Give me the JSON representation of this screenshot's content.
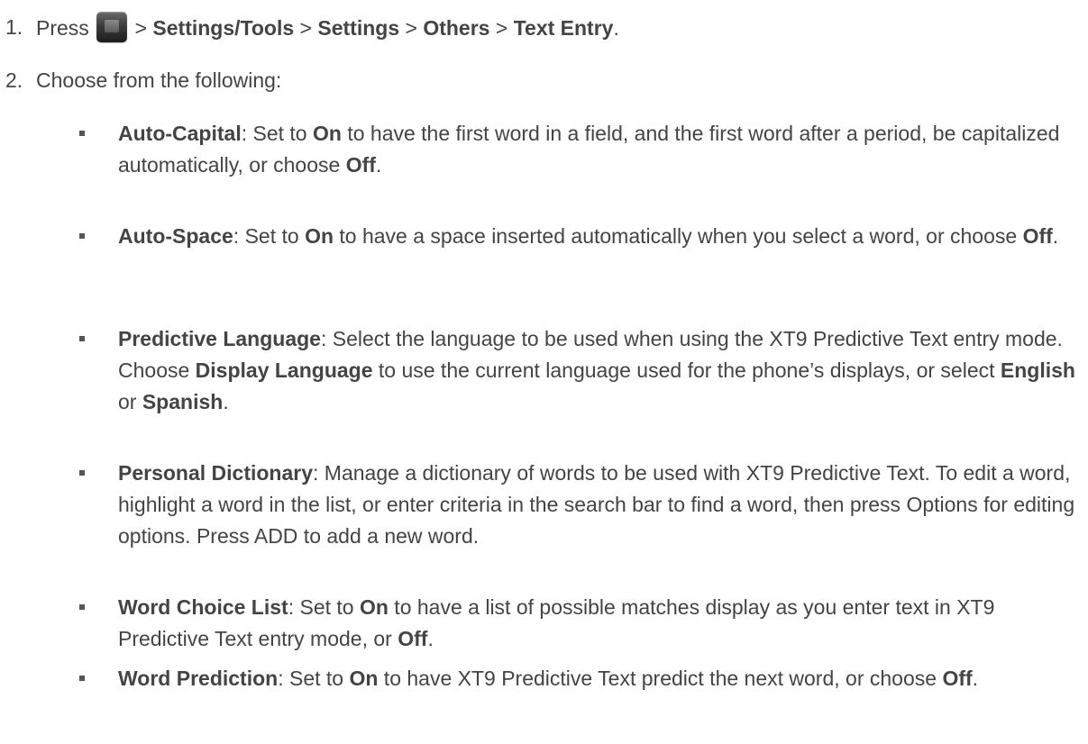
{
  "steps": [
    {
      "number": "1.",
      "press": "Press",
      "icon": "menu-key-icon",
      "sep1": " > ",
      "path1": "Settings/Tools",
      "sep2": " > ",
      "path2": "Settings",
      "sep3": " > ",
      "path3": "Others",
      "sep4": " > ",
      "path4": "Text Entry",
      "end": "."
    },
    {
      "number": "2.",
      "text": "Choose from the following:"
    }
  ],
  "options": [
    {
      "term": "Auto-Capital",
      "parts": [
        {
          "t": ": Set to ",
          "b": false
        },
        {
          "t": "On",
          "b": true
        },
        {
          "t": " to have the first word in a field, and the first word after a period, be capitalized automatically, or choose ",
          "b": false
        },
        {
          "t": "Off",
          "b": true
        },
        {
          "t": ".",
          "b": false
        }
      ]
    },
    {
      "term": "Auto-Space",
      "parts": [
        {
          "t": ": Set to ",
          "b": false
        },
        {
          "t": "On",
          "b": true
        },
        {
          "t": " to have a space inserted automatically when you select a word, or choose ",
          "b": false
        },
        {
          "t": "Off",
          "b": true
        },
        {
          "t": ".",
          "b": false
        }
      ]
    },
    {
      "term": "Predictive Language",
      "parts": [
        {
          "t": ": Select the language to be used when using the XT9 Predictive Text entry mode. Choose ",
          "b": false
        },
        {
          "t": "Display Language",
          "b": true
        },
        {
          "t": " to use the current language used for the phone’s displays, or select ",
          "b": false
        },
        {
          "t": "English",
          "b": true
        },
        {
          "t": " or ",
          "b": false
        },
        {
          "t": "Spanish",
          "b": true
        },
        {
          "t": ".",
          "b": false
        }
      ]
    },
    {
      "term": "Personal Dictionary",
      "parts": [
        {
          "t": ": Manage a dictionary of words to be used with XT9 Predictive Text. To edit a word, highlight a word in the list, or enter criteria in the search bar to find a word, then press Options for editing options. Press ADD to add a new word.",
          "b": false
        }
      ]
    },
    {
      "term": "Word Choice List",
      "parts": [
        {
          "t": ": Set to ",
          "b": false
        },
        {
          "t": "On",
          "b": true
        },
        {
          "t": " to have a list of possible matches display as you enter text in XT9 Predictive Text entry mode, or ",
          "b": false
        },
        {
          "t": "Off",
          "b": true
        },
        {
          "t": ".",
          "b": false
        }
      ]
    },
    {
      "term": "Word Prediction",
      "parts": [
        {
          "t": ": Set to ",
          "b": false
        },
        {
          "t": "On",
          "b": true
        },
        {
          "t": " to have XT9 Predictive Text predict the next word, or choose ",
          "b": false
        },
        {
          "t": "Off",
          "b": true
        },
        {
          "t": ".",
          "b": false
        }
      ]
    }
  ]
}
